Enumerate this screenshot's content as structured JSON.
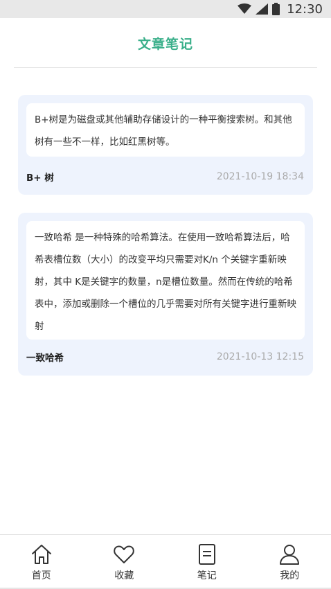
{
  "status_bar": {
    "time": "12:30"
  },
  "header": {
    "title": "文章笔记"
  },
  "notes": [
    {
      "content": "B+树是为磁盘或其他辅助存储设计的一种平衡搜索树。和其他树有一些不一样，比如红黑树等。",
      "title": "B+ 树",
      "date": "2021-10-19 18:34"
    },
    {
      "content": "一致哈希 是一种特殊的哈希算法。在使用一致哈希算法后，哈希表槽位数（大小）的改变平均只需要对K/n 个关键字重新映射，其中 K是关键字的数量，n是槽位数量。然而在传统的哈希表中，添加或删除一个槽位的几乎需要对所有关键字进行重新映射",
      "title": "一致哈希",
      "date": "2021-10-13 12:15"
    }
  ],
  "tabbar": {
    "items": [
      {
        "label": "首页",
        "icon": "home-icon"
      },
      {
        "label": "收藏",
        "icon": "heart-icon"
      },
      {
        "label": "笔记",
        "icon": "note-icon"
      },
      {
        "label": "我的",
        "icon": "user-icon"
      }
    ]
  },
  "colors": {
    "accent": "#3aaf8a",
    "card_bg": "#eef3fd",
    "date_text": "#aaaaaa"
  }
}
